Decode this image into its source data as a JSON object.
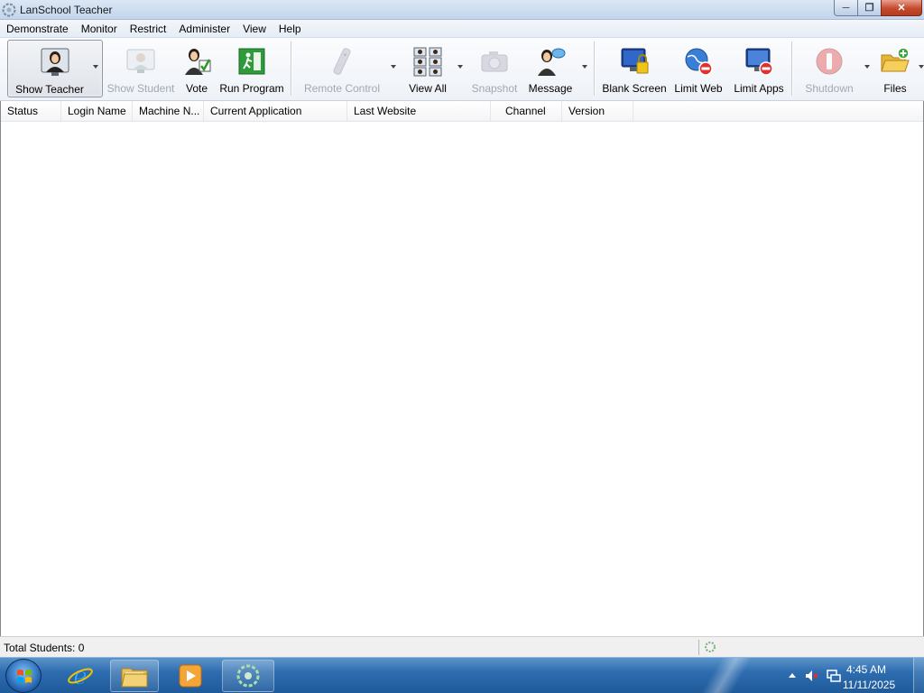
{
  "window": {
    "title": "LanSchool Teacher"
  },
  "menu": [
    "Demonstrate",
    "Monitor",
    "Restrict",
    "Administer",
    "View",
    "Help"
  ],
  "toolbar": {
    "show_teacher": "Show Teacher",
    "show_student": "Show Student",
    "vote": "Vote",
    "run_program": "Run Program",
    "remote_control": "Remote Control",
    "view_all": "View All",
    "snapshot": "Snapshot",
    "message": "Message",
    "blank_screen": "Blank Screen",
    "limit_web": "Limit Web",
    "limit_apps": "Limit Apps",
    "shutdown": "Shutdown",
    "files": "Files"
  },
  "list": {
    "columns": [
      "Status",
      "Login Name",
      "Machine N...",
      "Current Application",
      "Last Website",
      "Channel",
      "Version"
    ],
    "rows": []
  },
  "status": {
    "total_students": "Total Students: 0"
  },
  "taskbar": {
    "time": "4:45 AM",
    "date": "11/11/2025",
    "items": [
      "start-button",
      "internet-explorer-icon",
      "file-explorer-icon",
      "media-player-icon",
      "lanschool-icon"
    ]
  },
  "colors": {
    "taskbar": "#2d6db0",
    "close_button": "#c44a2d",
    "disabled_text": "#a2a8b0"
  }
}
